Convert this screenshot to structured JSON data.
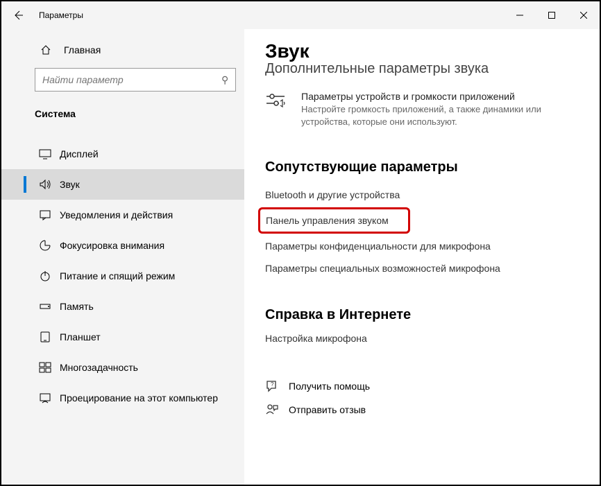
{
  "titlebar": {
    "title": "Параметры"
  },
  "sidebar": {
    "home": "Главная",
    "search_placeholder": "Найти параметр",
    "category": "Система",
    "items": [
      {
        "label": "Дисплей"
      },
      {
        "label": "Звук"
      },
      {
        "label": "Уведомления и действия"
      },
      {
        "label": "Фокусировка внимания"
      },
      {
        "label": "Питание и спящий режим"
      },
      {
        "label": "Память"
      },
      {
        "label": "Планшет"
      },
      {
        "label": "Многозадачность"
      },
      {
        "label": "Проецирование на этот компьютер"
      }
    ]
  },
  "content": {
    "page_title": "Звук",
    "sub_title": "Дополнительные параметры звука",
    "advanced": {
      "title": "Параметры устройств и громкости приложений",
      "desc": "Настройте громкость приложений, а также динамики или устройства, которые они используют."
    },
    "related_title": "Сопутствующие параметры",
    "links": [
      "Bluetooth и другие устройства",
      "Панель управления звуком",
      "Параметры конфиденциальности для микрофона",
      "Параметры специальных возможностей микрофона"
    ],
    "help_title": "Справка в Интернете",
    "help_link": "Настройка микрофона",
    "footer": {
      "get_help": "Получить помощь",
      "feedback": "Отправить отзыв"
    }
  }
}
